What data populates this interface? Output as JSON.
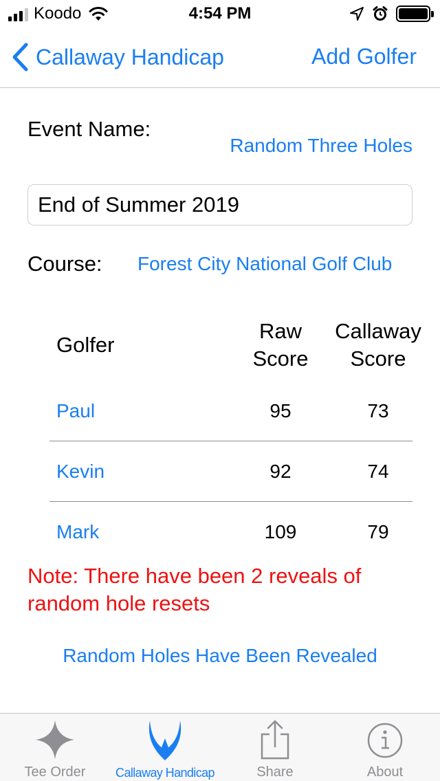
{
  "status_bar": {
    "carrier": "Koodo",
    "time": "4:54 PM"
  },
  "nav": {
    "back_label": "Callaway Handicap",
    "add_label": "Add Golfer"
  },
  "form": {
    "event_name_label": "Event Name:",
    "random_link": "Random Three Holes",
    "event_name_value": "End of Summer 2019",
    "course_label": "Course:",
    "course_value": "Forest City National Golf Club"
  },
  "table": {
    "headers": {
      "golfer": "Golfer",
      "raw_line1": "Raw",
      "raw_line2": "Score",
      "callaway_line1": "Callaway",
      "callaway_line2": "Score"
    },
    "rows": [
      {
        "name": "Paul",
        "raw": "95",
        "callaway": "73"
      },
      {
        "name": "Kevin",
        "raw": "92",
        "callaway": "74"
      },
      {
        "name": "Mark",
        "raw": "109",
        "callaway": "79"
      }
    ]
  },
  "note": "Note: There have been 2 reveals of random hole resets",
  "revealed_link": "Random Holes Have Been Revealed",
  "tabs": [
    {
      "label": "Tee Order",
      "icon": "star-icon"
    },
    {
      "label": "Callaway Handicap",
      "icon": "horns-icon",
      "active": true
    },
    {
      "label": "Share",
      "icon": "share-icon"
    },
    {
      "label": "About",
      "icon": "info-icon"
    }
  ],
  "colors": {
    "accent": "#1a7ef2",
    "note": "#ee1111",
    "tab_inactive": "#8e8e93"
  }
}
